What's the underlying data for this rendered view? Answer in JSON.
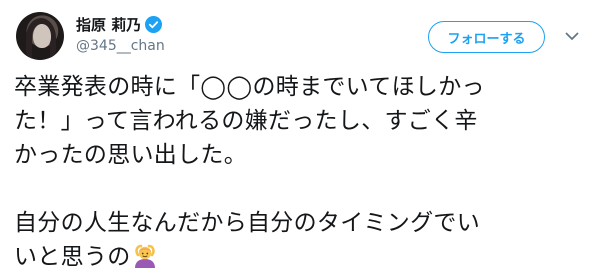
{
  "author": {
    "display_name": "指原 莉乃",
    "handle": "@345__chan",
    "verified": true
  },
  "follow_button": {
    "label": "フォローする"
  },
  "menu": {
    "icon": "chevron-down-icon"
  },
  "tweet": {
    "lines": [
      "卒業発表の時に「◯◯の時までいてほしかっ",
      "た！」って言われるの嫌だったし、すごく辛",
      "かったの思い出した。",
      "自分の人生なんだから自分のタイミングでい",
      "いと思うの"
    ],
    "emoji": "woman-gesturing-ok"
  },
  "colors": {
    "accent": "#1da1f2",
    "text": "#14171a",
    "secondary": "#657786"
  }
}
